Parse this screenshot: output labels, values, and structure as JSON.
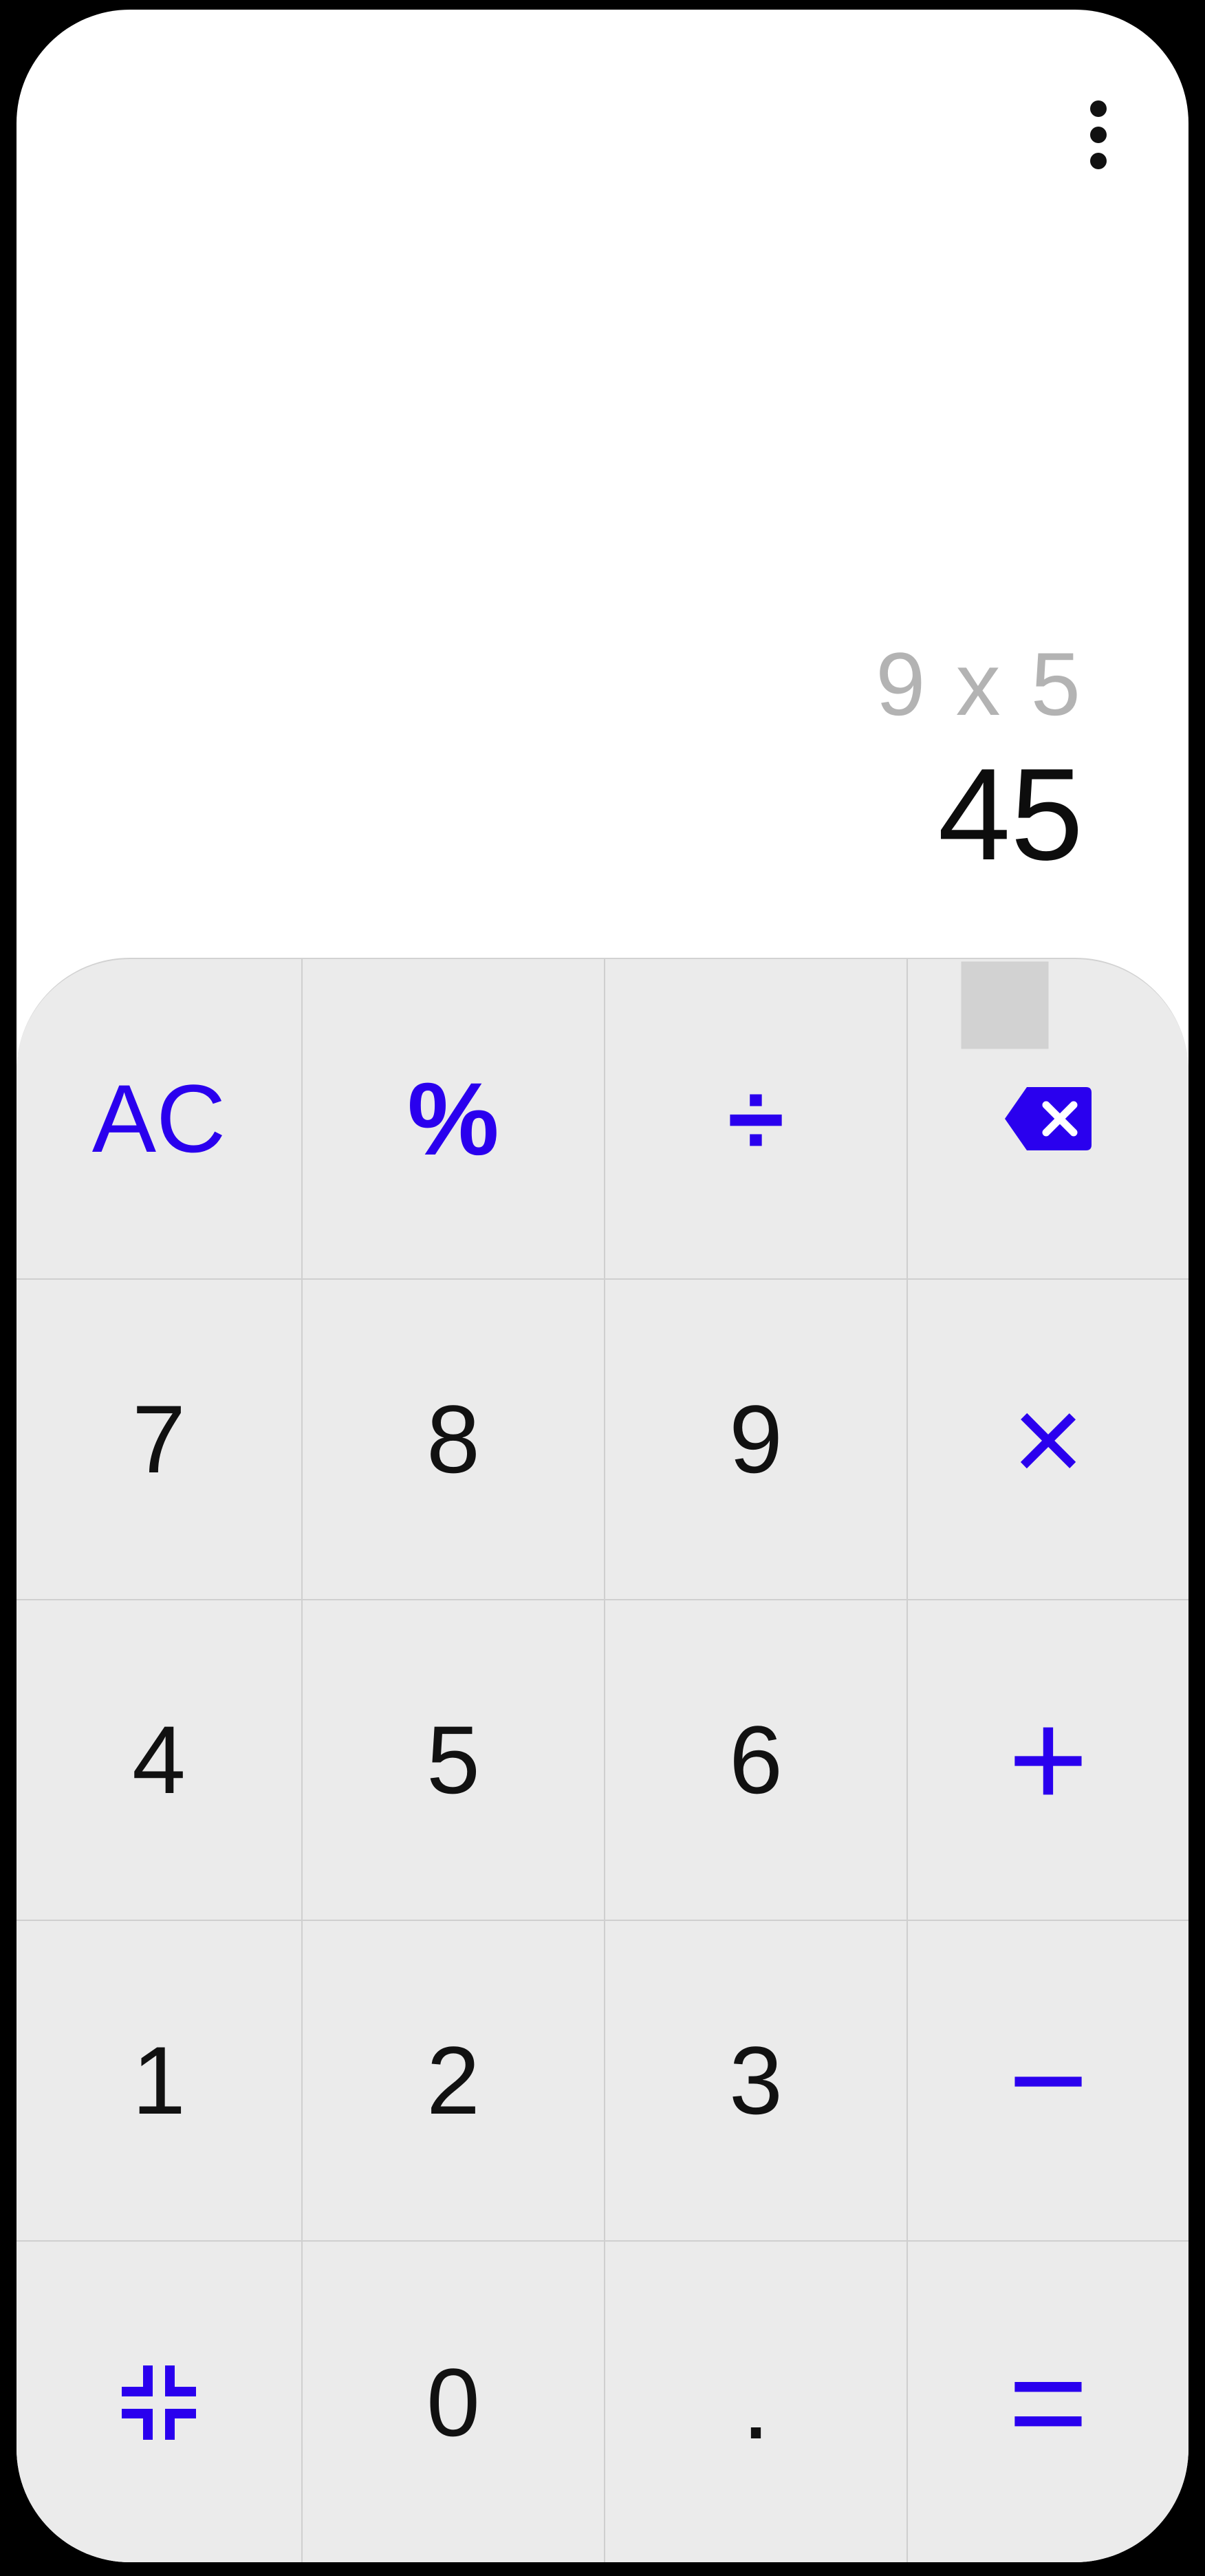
{
  "display": {
    "expression": "9 x 5",
    "result": "45"
  },
  "keypad": {
    "row1": {
      "clear": "AC",
      "percent": "%",
      "divide": "÷"
    },
    "row2": {
      "seven": "7",
      "eight": "8",
      "nine": "9",
      "multiply": "×"
    },
    "row3": {
      "four": "4",
      "five": "5",
      "six": "6",
      "plus": "+"
    },
    "row4": {
      "one": "1",
      "two": "2",
      "three": "3",
      "minus": "−"
    },
    "row5": {
      "zero": "0",
      "decimal": ".",
      "equals": "="
    }
  },
  "icons": {
    "menu": "more-vert-icon",
    "backspace": "backspace-icon",
    "collapse": "collapse-icon"
  },
  "colors": {
    "accent": "#2a00ee",
    "keypad_bg": "#ebebeb",
    "expression": "#b3b3b3",
    "result": "#0d0d0d"
  }
}
